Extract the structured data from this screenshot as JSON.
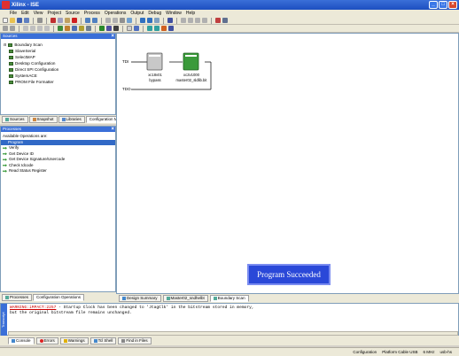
{
  "window": {
    "title": "Xilinx - ISE"
  },
  "menu": [
    "File",
    "Edit",
    "View",
    "Project",
    "Source",
    "Process",
    "Operations",
    "Output",
    "Debug",
    "Window",
    "Help"
  ],
  "sources": {
    "header": "Sources",
    "items": [
      "Boundary Scan",
      "SlaveSerial",
      "SelectMAP",
      "Desktop Configuration",
      "Direct SPI Configuration",
      "SystemACE",
      "PROM File Formatter"
    ],
    "tabs": [
      "Sources",
      "Snapshot",
      "Libraries",
      "Configuration Mod"
    ]
  },
  "processes": {
    "header": "Processes",
    "title": "Available Operations are:",
    "items": [
      "Program",
      "Verify",
      "Get Device ID",
      "Get Device Signature/Usercode",
      "Check Idcode",
      "Read Status Register"
    ],
    "selected_index": 0,
    "tabs": [
      "Processes",
      "Configuration Operations"
    ]
  },
  "chain": {
    "tdi": "TDI",
    "tdo": "TDO",
    "devices": [
      {
        "part": "xc18v01",
        "file": "bypass"
      },
      {
        "part": "xc2v1000",
        "file": "master02_sldlib.bit"
      }
    ]
  },
  "editor_tabs": [
    "Design Summary",
    "Master02_sndhelbt",
    "Boundary Scan"
  ],
  "success_message": "Program Succeeded",
  "console": {
    "side_label": "Transcript",
    "lines": [
      "WARNING:iMPACT:2257 - Startup Clock has been changed to 'JtagClk' in the bitstream stored in memory,",
      "but the original bitstream file remains unchanged."
    ]
  },
  "console_tabs": [
    "Console",
    "Errors",
    "Warnings",
    "Tcl Shell",
    "Find in Files"
  ],
  "status": [
    "Configuration",
    "Platform Cable USB",
    "6 MHz",
    "usb-hs"
  ]
}
